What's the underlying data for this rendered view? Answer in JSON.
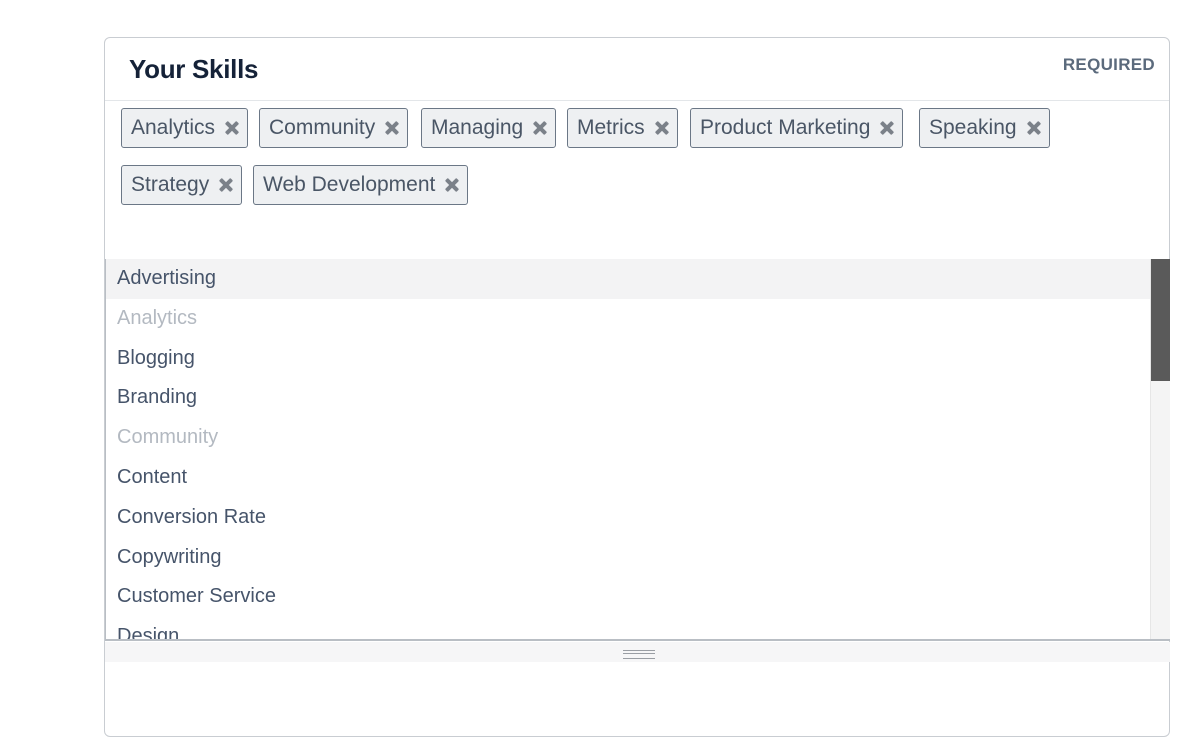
{
  "header": {
    "title": "Your Skills",
    "required_label": "REQUIRED"
  },
  "selected_tags": [
    {
      "label": "Analytics",
      "remove_icon": "close-icon"
    },
    {
      "label": "Community",
      "remove_icon": "close-icon"
    },
    {
      "label": "Managing",
      "remove_icon": "close-icon"
    },
    {
      "label": "Metrics",
      "remove_icon": "close-icon"
    },
    {
      "label": "Product Marketing",
      "remove_icon": "close-icon"
    },
    {
      "label": "Speaking",
      "remove_icon": "close-icon"
    },
    {
      "label": "Strategy",
      "remove_icon": "close-icon"
    },
    {
      "label": "Web Development",
      "remove_icon": "close-icon"
    }
  ],
  "dropdown": {
    "options": [
      {
        "label": "Advertising",
        "state": "highlighted"
      },
      {
        "label": "Analytics",
        "state": "disabled"
      },
      {
        "label": "Blogging",
        "state": "normal"
      },
      {
        "label": "Branding",
        "state": "normal"
      },
      {
        "label": "Community",
        "state": "disabled"
      },
      {
        "label": "Content",
        "state": "normal"
      },
      {
        "label": "Conversion Rate",
        "state": "normal"
      },
      {
        "label": "Copywriting",
        "state": "normal"
      },
      {
        "label": "Customer Service",
        "state": "normal"
      },
      {
        "label": "Design",
        "state": "normal"
      }
    ]
  },
  "colors": {
    "title": "#152238",
    "tag_border": "#6b7786",
    "tag_background": "#eef0f2",
    "option_text": "#46546a",
    "option_disabled": "#b3b9c1",
    "highlight_background": "#f3f3f4",
    "scroll_thumb": "#5a5a5a"
  }
}
